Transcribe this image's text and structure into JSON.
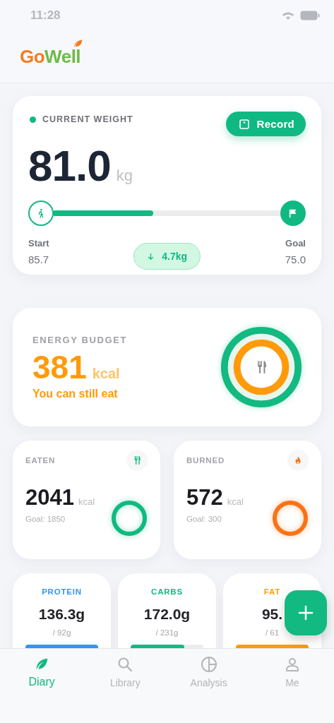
{
  "status_bar": {
    "time": "11:28"
  },
  "header": {
    "logo": [
      "Go",
      "Well"
    ]
  },
  "weight_card": {
    "label": "CURRENT WEIGHT",
    "record_button": "Record",
    "value": "81.0",
    "unit": "kg",
    "progress": {
      "level": 0.44
    },
    "start": {
      "label": "Start",
      "value": "85.7"
    },
    "change": "4.7kg",
    "goal": {
      "label": "Goal",
      "value": "75.0"
    }
  },
  "energy_card": {
    "label": "ENERGY BUDGET",
    "value": "381",
    "unit": "kcal",
    "note": "You can still eat"
  },
  "summary_cards": [
    {
      "kind": "eaten",
      "label": "EATEN",
      "value": "2041",
      "unit": "kcal",
      "goal": "Goal: 1850",
      "color": "#10b981"
    },
    {
      "kind": "burned",
      "label": "BURNED",
      "value": "572",
      "unit": "kcal",
      "goal": "Goal: 300",
      "color": "#f97316"
    }
  ],
  "macros": [
    {
      "label": "PROTEIN",
      "value": "136.3g",
      "target": "/ 92g",
      "level": 1,
      "color": "#2e96f5"
    },
    {
      "label": "CARBS",
      "value": "172.0g",
      "target": "/ 231g",
      "level": 0.74,
      "color": "#12b981"
    },
    {
      "label": "FAT",
      "value": "95.",
      "target": "/ 61",
      "level": 1,
      "color": "#ff9a0a"
    }
  ],
  "tabs": [
    {
      "kind": "leaf",
      "label": "Diary",
      "selected": true
    },
    {
      "kind": "search",
      "label": "Library",
      "selected": false
    },
    {
      "kind": "chart",
      "label": "Analysis",
      "selected": false
    },
    {
      "kind": "person",
      "label": "Me",
      "selected": false
    }
  ]
}
